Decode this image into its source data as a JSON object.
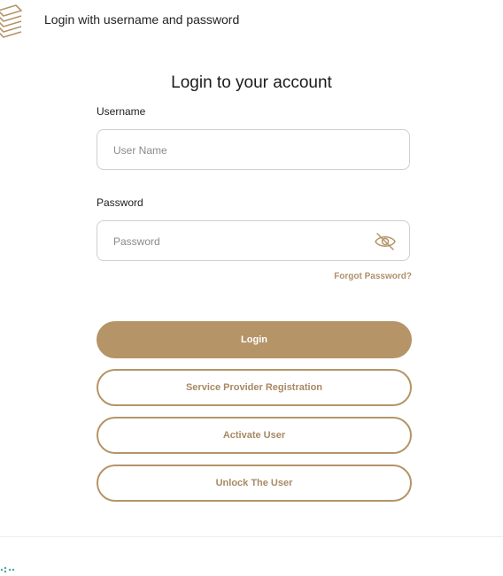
{
  "header": {
    "title": "Login with username and password"
  },
  "form": {
    "title": "Login to your account",
    "username": {
      "label": "Username",
      "placeholder": "User Name",
      "value": ""
    },
    "password": {
      "label": "Password",
      "placeholder": "Password",
      "value": ""
    },
    "forgot_label": "Forgot Password?"
  },
  "buttons": {
    "login": "Login",
    "register": "Service Provider Registration",
    "activate": "Activate User",
    "unlock": "Unlock The User"
  },
  "icons": {
    "logo": "stacked-layers-logo",
    "password_toggle": "eye-off-icon"
  },
  "colors": {
    "accent": "#b59467",
    "accent_text": "#a88963",
    "border": "#cfcfcf"
  }
}
